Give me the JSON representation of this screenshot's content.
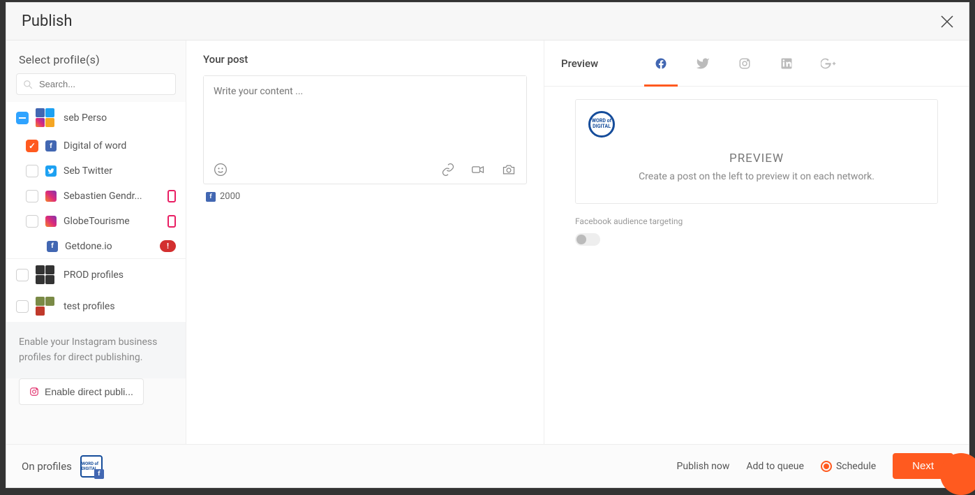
{
  "header": {
    "title": "Publish"
  },
  "sidebar": {
    "section_label": "Select profile(s)",
    "search_placeholder": "Search...",
    "groups": [
      {
        "name": "seb Perso",
        "state": "partial"
      }
    ],
    "profiles": [
      {
        "name": "Digital of word",
        "network": "fb",
        "checked": true
      },
      {
        "name": "Seb Twitter",
        "network": "tw",
        "checked": false
      },
      {
        "name": "Sebastien Gendr...",
        "network": "ig",
        "checked": false,
        "phone": true
      },
      {
        "name": "GlobeTourisme",
        "network": "ig",
        "checked": false,
        "phone": true
      },
      {
        "name": "Getdone.io",
        "network": "fb",
        "checked": false,
        "alert": "!"
      }
    ],
    "extra_groups": [
      {
        "name": "PROD profiles"
      },
      {
        "name": "test profiles"
      }
    ],
    "hint": "Enable your Instagram business profiles for direct publishing.",
    "enable_button": "Enable direct publi..."
  },
  "compose": {
    "title": "Your post",
    "placeholder": "Write your content ...",
    "char_count": "2000"
  },
  "preview": {
    "label": "Preview",
    "avatar_text": "WORD of DIGITAL",
    "title": "PREVIEW",
    "desc": "Create a post on the left to preview it on each network.",
    "targeting_label": "Facebook audience targeting"
  },
  "footer": {
    "on_profiles": "On profiles",
    "avatar_text": "WORD of DIGITAL",
    "publish_now": "Publish now",
    "add_queue": "Add to queue",
    "schedule": "Schedule",
    "next": "Next"
  }
}
